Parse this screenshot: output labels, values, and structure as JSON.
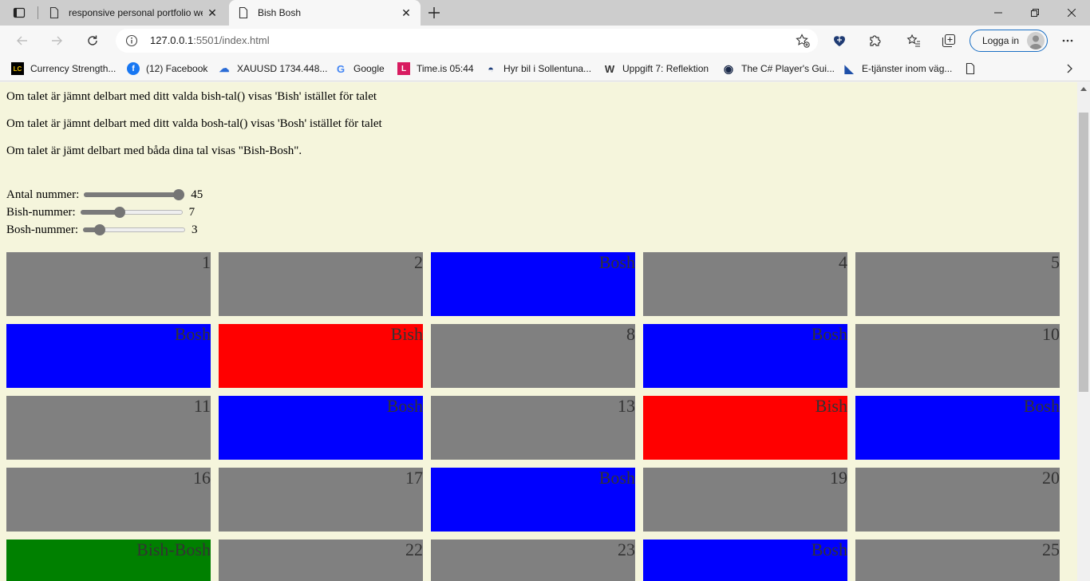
{
  "browser": {
    "tabs": [
      {
        "title": "responsive personal portfolio we",
        "active": false
      },
      {
        "title": "Bish Bosh",
        "active": true
      }
    ],
    "url_main": "127.0.0.1",
    "url_rest": ":5501/index.html",
    "login_label": "Logga in",
    "bookmarks": [
      {
        "label": "Currency Strength...",
        "icon": "lc-icon",
        "glyph": "LC",
        "color": "#000000"
      },
      {
        "label": "(12) Facebook",
        "icon": "facebook-icon",
        "glyph": "f",
        "color": "#1877f2"
      },
      {
        "label": "XAUUSD 1734.448...",
        "icon": "cloud-icon",
        "glyph": "☁",
        "color": "#2b6cd6"
      },
      {
        "label": "Google",
        "icon": "google-icon",
        "glyph": "G",
        "color": "#4285f4"
      },
      {
        "label": "Time.is 05:44",
        "icon": "timeis-icon",
        "glyph": "L",
        "color": "#d81b60"
      },
      {
        "label": "Hyr bil i Sollentuna...",
        "icon": "car-rental-icon",
        "glyph": "◓",
        "color": "#1c3d7a"
      },
      {
        "label": "Uppgift 7: Reflektion",
        "icon": "w-icon",
        "glyph": "W",
        "color": "#333333"
      },
      {
        "label": "The C# Player's Gui...",
        "icon": "csharp-icon",
        "glyph": "◉",
        "color": "#1b2a4a"
      },
      {
        "label": "E-tjänster inom väg...",
        "icon": "flag-icon",
        "glyph": "◣",
        "color": "#1e4fa8"
      },
      {
        "label": "",
        "icon": "page-icon",
        "glyph": "▯",
        "color": "#333333"
      }
    ]
  },
  "page": {
    "paragraphs": [
      "Om talet är jämnt delbart med ditt valda bish-tal() visas 'Bish' istället för talet",
      "Om talet är jämnt delbart med ditt valda bosh-tal() visas 'Bosh' istället för talet",
      "Om talet är jämt delbart med båda dina tal visas \"Bish-Bosh\"."
    ],
    "controls": [
      {
        "label": "Antal nummer:",
        "value": "45",
        "fraction": 1.0
      },
      {
        "label": "Bish-nummer:",
        "value": "7",
        "fraction": 0.375
      },
      {
        "label": "Bosh-nummer:",
        "value": "3",
        "fraction": 0.125
      }
    ],
    "colors": {
      "number": "#808080",
      "bish": "#ff0000",
      "bosh": "#0000ff",
      "bishbosh": "#008000"
    },
    "cells": [
      {
        "text": "1",
        "kind": "number"
      },
      {
        "text": "2",
        "kind": "number"
      },
      {
        "text": "Bosh",
        "kind": "bosh"
      },
      {
        "text": "4",
        "kind": "number"
      },
      {
        "text": "5",
        "kind": "number"
      },
      {
        "text": "Bosh",
        "kind": "bosh"
      },
      {
        "text": "Bish",
        "kind": "bish"
      },
      {
        "text": "8",
        "kind": "number"
      },
      {
        "text": "Bosh",
        "kind": "bosh"
      },
      {
        "text": "10",
        "kind": "number"
      },
      {
        "text": "11",
        "kind": "number"
      },
      {
        "text": "Bosh",
        "kind": "bosh"
      },
      {
        "text": "13",
        "kind": "number"
      },
      {
        "text": "Bish",
        "kind": "bish"
      },
      {
        "text": "Bosh",
        "kind": "bosh"
      },
      {
        "text": "16",
        "kind": "number"
      },
      {
        "text": "17",
        "kind": "number"
      },
      {
        "text": "Bosh",
        "kind": "bosh"
      },
      {
        "text": "19",
        "kind": "number"
      },
      {
        "text": "20",
        "kind": "number"
      },
      {
        "text": "Bish-Bosh",
        "kind": "bishbosh"
      },
      {
        "text": "22",
        "kind": "number"
      },
      {
        "text": "23",
        "kind": "number"
      },
      {
        "text": "Bosh",
        "kind": "bosh"
      },
      {
        "text": "25",
        "kind": "number"
      }
    ]
  }
}
